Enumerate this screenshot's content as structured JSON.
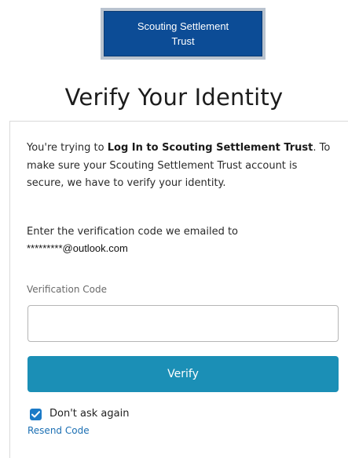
{
  "logo": {
    "line1": "Scouting Settlement",
    "line2": "Trust",
    "background_color": "#0c4c96"
  },
  "page": {
    "title": "Verify Your Identity"
  },
  "message": {
    "part1": "You're trying to ",
    "action": "Log In to Scouting Settlement Trust",
    "part2": ". To make sure your Scouting Settlement Trust account is secure, we have to verify your identity."
  },
  "code_prompt": {
    "text": "Enter the verification code we emailed to",
    "email": "*********@outlook.com"
  },
  "form": {
    "code_label": "Verification Code",
    "code_value": "",
    "verify_label": "Verify",
    "verify_color": "#1b8fb6",
    "remember_checked": true,
    "remember_label": "Don't ask again",
    "resend_label": "Resend Code"
  }
}
